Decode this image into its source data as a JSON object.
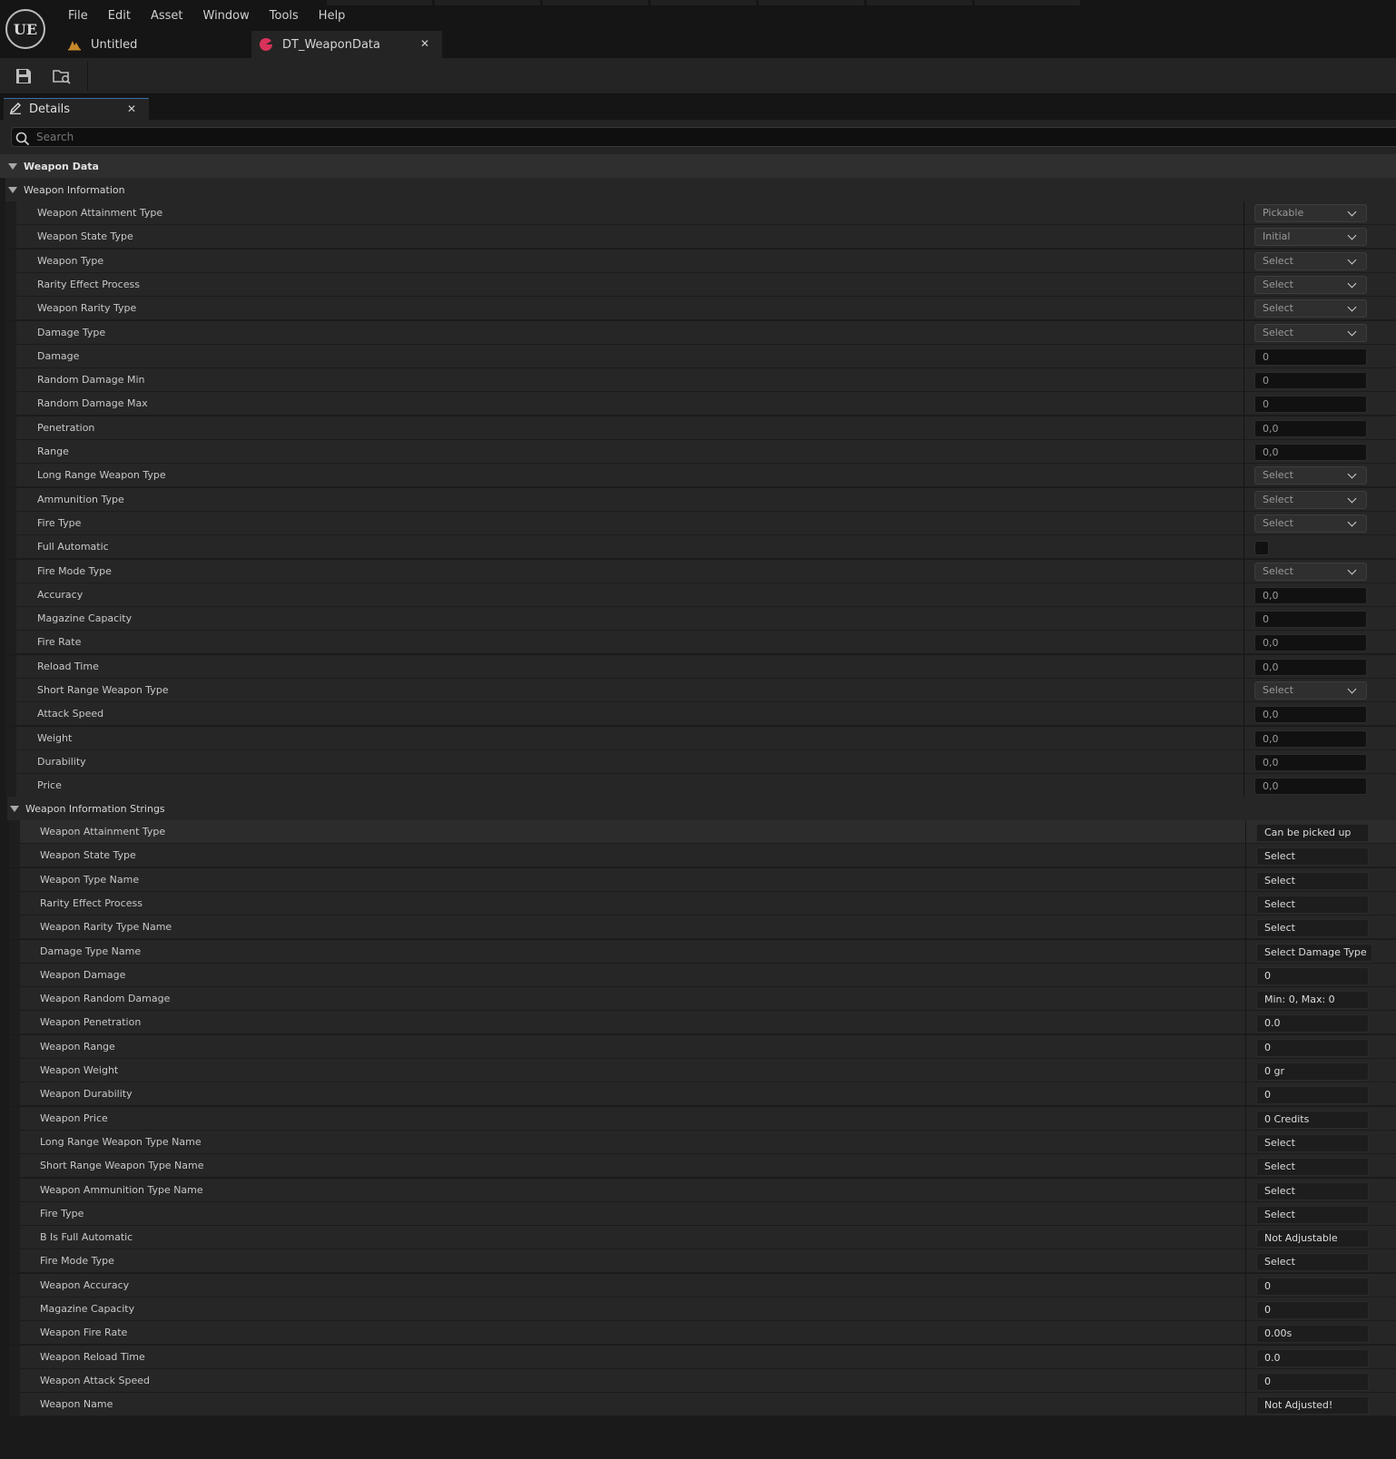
{
  "app": {
    "logo": "UE",
    "menu": [
      "File",
      "Edit",
      "Asset",
      "Window",
      "Tools",
      "Help"
    ],
    "tabs": [
      {
        "label": "Untitled",
        "icon": "level-icon"
      },
      {
        "label": "DT_WeaponData",
        "icon": "data-table-icon",
        "close": "✕"
      }
    ]
  },
  "toolbar": {
    "buttons": [
      "save-icon",
      "browse-icon"
    ]
  },
  "details": {
    "tab_label": "Details",
    "tab_close": "✕",
    "search_placeholder": "Search"
  },
  "categories": {
    "weapon_data": "Weapon Data",
    "weapon_information": "Weapon Information",
    "weapon_information_strings": "Weapon Information Strings"
  },
  "weapon_information": [
    {
      "label": "Weapon Attainment Type",
      "kind": "combo",
      "value": "Pickable"
    },
    {
      "label": "Weapon State Type",
      "kind": "combo",
      "value": "Initial"
    },
    {
      "label": "Weapon Type",
      "kind": "combo",
      "value": "Select"
    },
    {
      "label": "Rarity Effect Process",
      "kind": "combo",
      "value": "Select"
    },
    {
      "label": "Weapon Rarity Type",
      "kind": "combo",
      "value": "Select"
    },
    {
      "label": "Damage Type",
      "kind": "combo",
      "value": "Select"
    },
    {
      "label": "Damage",
      "kind": "number",
      "value": "0"
    },
    {
      "label": "Random Damage Min",
      "kind": "number",
      "value": "0"
    },
    {
      "label": "Random Damage Max",
      "kind": "number",
      "value": "0"
    },
    {
      "label": "Penetration",
      "kind": "number",
      "value": "0,0"
    },
    {
      "label": "Range",
      "kind": "number",
      "value": "0,0"
    },
    {
      "label": "Long Range Weapon Type",
      "kind": "combo",
      "value": "Select"
    },
    {
      "label": "Ammunition Type",
      "kind": "combo",
      "value": "Select"
    },
    {
      "label": "Fire Type",
      "kind": "combo",
      "value": "Select"
    },
    {
      "label": "Full Automatic",
      "kind": "checkbox",
      "value": "false"
    },
    {
      "label": "Fire Mode Type",
      "kind": "combo",
      "value": "Select"
    },
    {
      "label": "Accuracy",
      "kind": "number",
      "value": "0,0"
    },
    {
      "label": "Magazine Capacity",
      "kind": "number",
      "value": "0"
    },
    {
      "label": "Fire Rate",
      "kind": "number",
      "value": "0,0"
    },
    {
      "label": "Reload Time",
      "kind": "number",
      "value": "0,0"
    },
    {
      "label": "Short Range Weapon Type",
      "kind": "combo",
      "value": "Select"
    },
    {
      "label": "Attack Speed",
      "kind": "number",
      "value": "0,0"
    },
    {
      "label": "Weight",
      "kind": "number",
      "value": "0,0"
    },
    {
      "label": "Durability",
      "kind": "number",
      "value": "0,0"
    },
    {
      "label": "Price",
      "kind": "number",
      "value": "0,0"
    }
  ],
  "weapon_information_strings": [
    {
      "label": "Weapon Attainment Type",
      "value": "Can be picked up"
    },
    {
      "label": "Weapon State Type",
      "value": "Select"
    },
    {
      "label": "Weapon Type Name",
      "value": "Select"
    },
    {
      "label": "Rarity Effect Process",
      "value": "Select"
    },
    {
      "label": "Weapon Rarity Type Name",
      "value": "Select"
    },
    {
      "label": "Damage Type Name",
      "value": "Select Damage Type"
    },
    {
      "label": "Weapon Damage",
      "value": "0"
    },
    {
      "label": "Weapon Random Damage",
      "value": "Min: 0, Max: 0"
    },
    {
      "label": "Weapon Penetration",
      "value": "0.0"
    },
    {
      "label": "Weapon Range",
      "value": "0"
    },
    {
      "label": "Weapon Weight",
      "value": "0 gr"
    },
    {
      "label": "Weapon Durability",
      "value": "0"
    },
    {
      "label": "Weapon Price",
      "value": "0 Credits"
    },
    {
      "label": "Long Range Weapon Type Name",
      "value": "Select"
    },
    {
      "label": "Short Range Weapon Type Name",
      "value": "Select"
    },
    {
      "label": "Weapon Ammunition Type Name",
      "value": "Select"
    },
    {
      "label": "Fire Type",
      "value": "Select"
    },
    {
      "label": "B Is Full Automatic",
      "value": "Not Adjustable"
    },
    {
      "label": "Fire Mode Type",
      "value": "Select"
    },
    {
      "label": "Weapon Accuracy",
      "value": "0"
    },
    {
      "label": "Magazine Capacity",
      "value": "0"
    },
    {
      "label": "Weapon Fire Rate",
      "value": "0.00s"
    },
    {
      "label": "Weapon Reload Time",
      "value": "0.0"
    },
    {
      "label": "Weapon Attack Speed",
      "value": "0"
    },
    {
      "label": "Weapon Name",
      "value": "Not Adjusted!"
    }
  ],
  "colors": {
    "accent_tab_icon": "#d8325a",
    "level_icon": "#c9892a",
    "active_tab_border": "#3b6fa8"
  }
}
